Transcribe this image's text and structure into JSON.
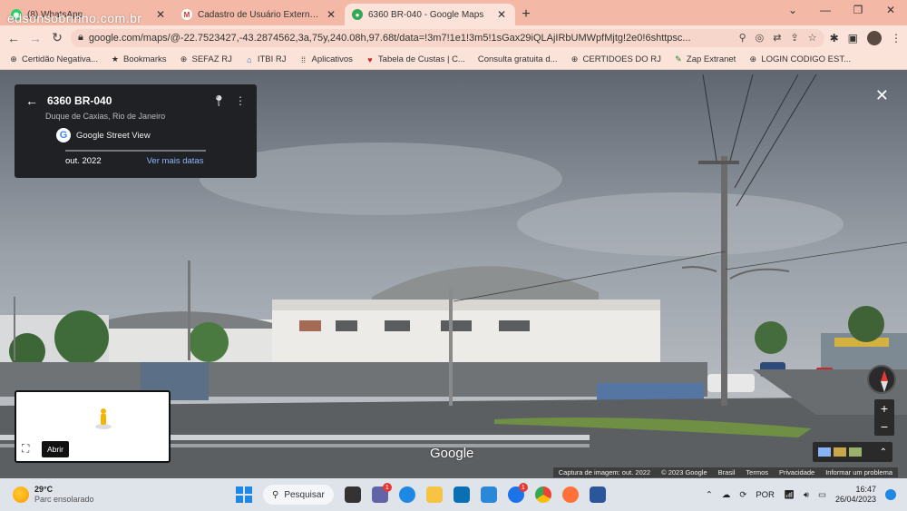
{
  "overlay_watermark": "edsonsobrinho.com.br",
  "browser": {
    "tabs": [
      {
        "title": "(8) WhatsApp",
        "icon": "whatsapp-icon",
        "color": "#25d366",
        "active": false
      },
      {
        "title": "Cadastro de Usuário Externo no...",
        "icon": "gmail-icon",
        "color": "#d93025",
        "active": false
      },
      {
        "title": "6360 BR-040 - Google Maps",
        "icon": "maps-pin-icon",
        "color": "#34a853",
        "active": true
      }
    ],
    "url": "google.com/maps/@-22.7523427,-43.2874562,3a,75y,240.08h,97.68t/data=!3m7!1e1!3m5!1sGax29iQLAjIRbUMWpfMjtg!2e0!6shttpsc..."
  },
  "bookmarks": [
    {
      "label": "Certidão Negativa...",
      "icon": "globe-icon"
    },
    {
      "label": "Bookmarks",
      "icon": "star-icon"
    },
    {
      "label": "SEFAZ RJ",
      "icon": "globe-icon"
    },
    {
      "label": "ITBI RJ",
      "icon": "building-icon"
    },
    {
      "label": "Aplicativos",
      "icon": "apps-grid-icon"
    },
    {
      "label": "Tabela de Custas | C...",
      "icon": "bookmark-icon"
    },
    {
      "label": "Consulta gratuita d...",
      "icon": ""
    },
    {
      "label": "CERTIDOES DO RJ",
      "icon": "globe-icon"
    },
    {
      "label": "Zap Extranet",
      "icon": "zap-icon"
    },
    {
      "label": "LOGIN CODIGO EST...",
      "icon": "globe-icon"
    }
  ],
  "streetview": {
    "address": "6360 BR-040",
    "locality": "Duque de Caxias, Rio de Janeiro",
    "source": "Google Street View",
    "date": "out. 2022",
    "more_dates": "Ver mais datas",
    "watermark": "Google",
    "tooltip": "Abrir",
    "footer": [
      "Captura de imagem: out. 2022",
      "© 2023 Google",
      "Brasil",
      "Termos",
      "Privacidade",
      "Informar um problema"
    ]
  },
  "taskbar": {
    "temperature": "29°C",
    "condition": "Parc ensolarado",
    "search_label": "Pesquisar",
    "language": "POR",
    "time": "16:47",
    "date": "26/04/2023",
    "badges": {
      "teams": "1",
      "edge": "1"
    }
  }
}
